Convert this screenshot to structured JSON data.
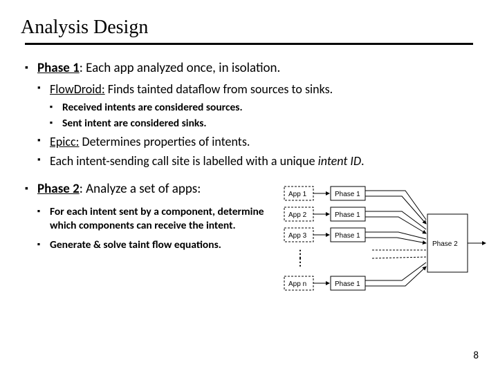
{
  "title": "Analysis Design",
  "phase1": {
    "heading_bold": "Phase 1",
    "heading_rest": ": Each app analyzed once, in isolation.",
    "flowdroid_label": "FlowDroid:",
    "flowdroid_rest": " Finds tainted dataflow from sources to sinks.",
    "fd_sub1": "Received intents are considered sources.",
    "fd_sub2": "Sent intent are considered sinks.",
    "epicc_label": "Epicc:",
    "epicc_rest": " Determines properties of intents.",
    "intentid_pre": "Each intent-sending call site is labelled with a unique ",
    "intentid_em": "intent ID",
    "intentid_post": "."
  },
  "phase2": {
    "heading_bold": "Phase 2",
    "heading_rest": ": Analyze a set of apps:",
    "p1_pre": "For each intent ",
    "p1_b1": "sent",
    "p1_mid": " by a component, determine which components can ",
    "p1_b2": "receive",
    "p1_post": " the intent.",
    "p2": "Generate & solve taint flow equations."
  },
  "diagram": {
    "app1": "App 1",
    "app2": "App 2",
    "app3": "App 3",
    "appn": "App n",
    "p1": "Phase 1",
    "p2": "Phase 2"
  },
  "page": "8"
}
